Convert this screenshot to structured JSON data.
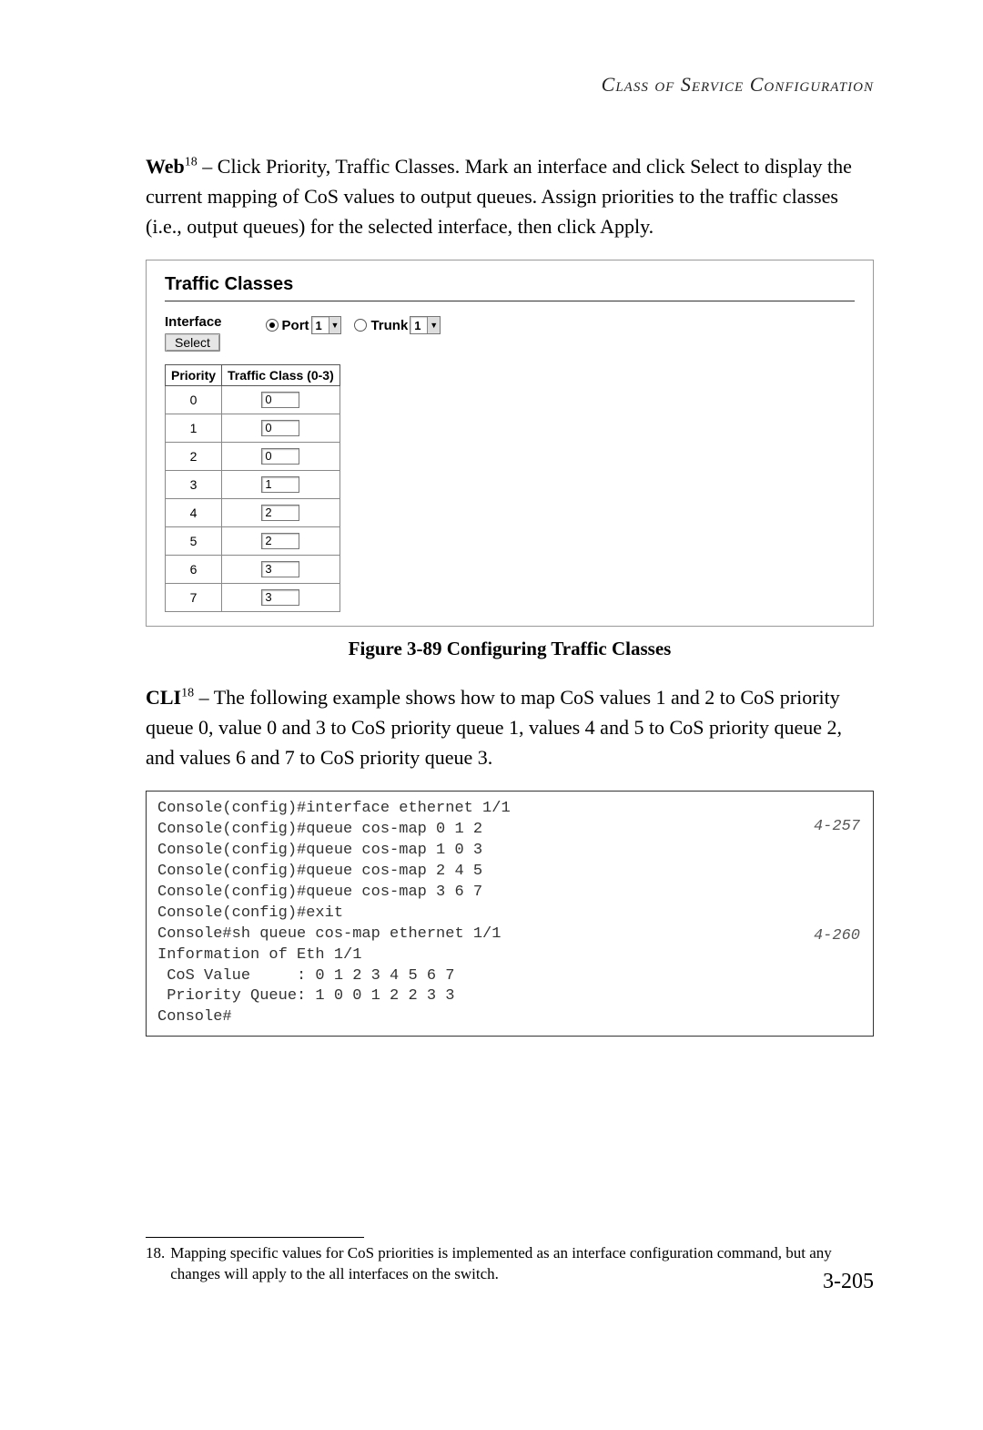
{
  "header": "Class of Service Configuration",
  "web_label": "Web",
  "web_fn": "18",
  "web_text": " – Click Priority, Traffic Classes. Mark an interface and click Select to display the current mapping of CoS values to output queues. Assign priorities to the traffic classes (i.e., output queues) for the selected interface, then click Apply.",
  "screenshot": {
    "title": "Traffic Classes",
    "interface_label": "Interface",
    "select_btn": "Select",
    "port_label": "Port",
    "port_value": "1",
    "trunk_label": "Trunk",
    "trunk_value": "1",
    "table_headers": {
      "col1": "Priority",
      "col2": "Traffic Class (0-3)"
    },
    "rows": [
      {
        "p": "0",
        "v": "0"
      },
      {
        "p": "1",
        "v": "0"
      },
      {
        "p": "2",
        "v": "0"
      },
      {
        "p": "3",
        "v": "1"
      },
      {
        "p": "4",
        "v": "2"
      },
      {
        "p": "5",
        "v": "2"
      },
      {
        "p": "6",
        "v": "3"
      },
      {
        "p": "7",
        "v": "3"
      }
    ]
  },
  "figure_caption": "Figure 3-89   Configuring Traffic Classes",
  "cli_label": "CLI",
  "cli_fn": "18",
  "cli_text": " – The following example shows how to map CoS values 1 and 2 to CoS priority queue 0, value 0 and 3 to CoS priority queue 1, values 4 and 5 to CoS priority queue 2, and values 6 and 7 to CoS priority queue 3.",
  "code": {
    "ref1": "4-257",
    "ref2": "4-260",
    "l1": "Console(config)#interface ethernet 1/1",
    "l2": "Console(config)#queue cos-map 0 1 2",
    "l3": "Console(config)#queue cos-map 1 0 3",
    "l4": "Console(config)#queue cos-map 2 4 5",
    "l5": "Console(config)#queue cos-map 3 6 7",
    "l6": "Console(config)#exit",
    "l7": "Console#sh queue cos-map ethernet 1/1",
    "l8": "Information of Eth 1/1",
    "l9": " CoS Value     : 0 1 2 3 4 5 6 7",
    "l10": " Priority Queue: 1 0 0 1 2 2 3 3",
    "l11": "Console#"
  },
  "footnote": {
    "num": "18.",
    "text": "Mapping specific values for CoS priorities is implemented as an interface configuration command, but any changes will apply to the all interfaces on the switch."
  },
  "pagenum": "3-205"
}
